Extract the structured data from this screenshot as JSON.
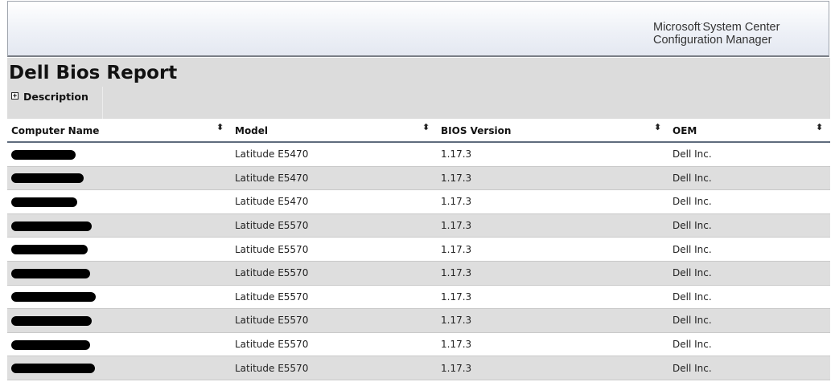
{
  "brand": {
    "line1_a": "Microsoft",
    "line1_sup": "·",
    "line1_b": "System Center",
    "line2": "Configuration Manager"
  },
  "report": {
    "title": "Dell Bios Report",
    "description_toggle": "Description"
  },
  "table": {
    "columns": [
      "Computer Name",
      "Model",
      "BIOS Version",
      "OEM"
    ],
    "rows": [
      {
        "computer_name": "",
        "model": "Latitude E5470",
        "bios_version": "1.17.3",
        "oem": "Dell Inc."
      },
      {
        "computer_name": "",
        "model": "Latitude E5470",
        "bios_version": "1.17.3",
        "oem": "Dell Inc."
      },
      {
        "computer_name": "",
        "model": "Latitude E5470",
        "bios_version": "1.17.3",
        "oem": "Dell Inc."
      },
      {
        "computer_name": "",
        "model": "Latitude E5570",
        "bios_version": "1.17.3",
        "oem": "Dell Inc."
      },
      {
        "computer_name": "",
        "model": "Latitude E5570",
        "bios_version": "1.17.3",
        "oem": "Dell Inc."
      },
      {
        "computer_name": "",
        "model": "Latitude E5570",
        "bios_version": "1.17.3",
        "oem": "Dell Inc."
      },
      {
        "computer_name": "",
        "model": "Latitude E5570",
        "bios_version": "1.17.3",
        "oem": "Dell Inc."
      },
      {
        "computer_name": "",
        "model": "Latitude E5570",
        "bios_version": "1.17.3",
        "oem": "Dell Inc."
      },
      {
        "computer_name": "",
        "model": "Latitude E5570",
        "bios_version": "1.17.3",
        "oem": "Dell Inc."
      },
      {
        "computer_name": "",
        "model": "Latitude E5570",
        "bios_version": "1.17.3",
        "oem": "Dell Inc."
      }
    ]
  },
  "icons": {
    "expand": "plus-box-icon",
    "sort": "sort-updown-icon"
  },
  "colors": {
    "header_band": "#dcdcdc",
    "alt_row": "#dedede",
    "header_rule": "#5f6b7d"
  }
}
